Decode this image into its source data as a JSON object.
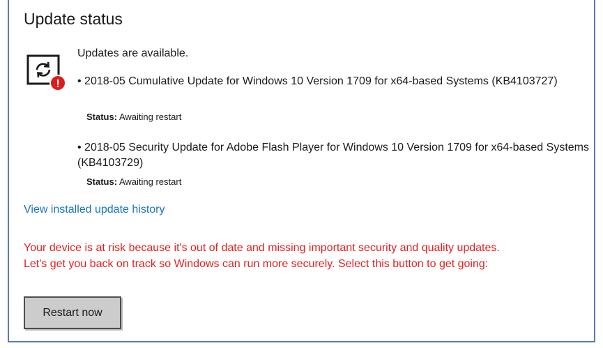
{
  "page": {
    "title": "Update status"
  },
  "summary": "Updates are available.",
  "icon": {
    "name": "update-warning-icon",
    "badge_glyph": "!",
    "badge_color": "#d81e1e"
  },
  "updates": [
    {
      "title": "• 2018-05 Cumulative Update for Windows 10 Version 1709 for x64-based Systems (KB4103727)",
      "status_label": "Status:",
      "status_value": " Awaiting restart"
    },
    {
      "title": "• 2018-05 Security Update for Adobe Flash Player for Windows 10 Version 1709 for x64-based Systems (KB4103729)",
      "status_label": "Status:",
      "status_value": " Awaiting restart"
    }
  ],
  "history_link": "View installed update history",
  "risk_message": {
    "line1": "Your device is at risk because it's out of date and missing important security and quality updates.",
    "line2": "Let's get you back on track so Windows can run more securely. Select this button to get going:"
  },
  "restart_button": "Restart now",
  "colors": {
    "link": "#1a73c8",
    "warning_text": "#e81e1e",
    "frame": "#5b79b0",
    "button_bg": "#cccccc"
  }
}
